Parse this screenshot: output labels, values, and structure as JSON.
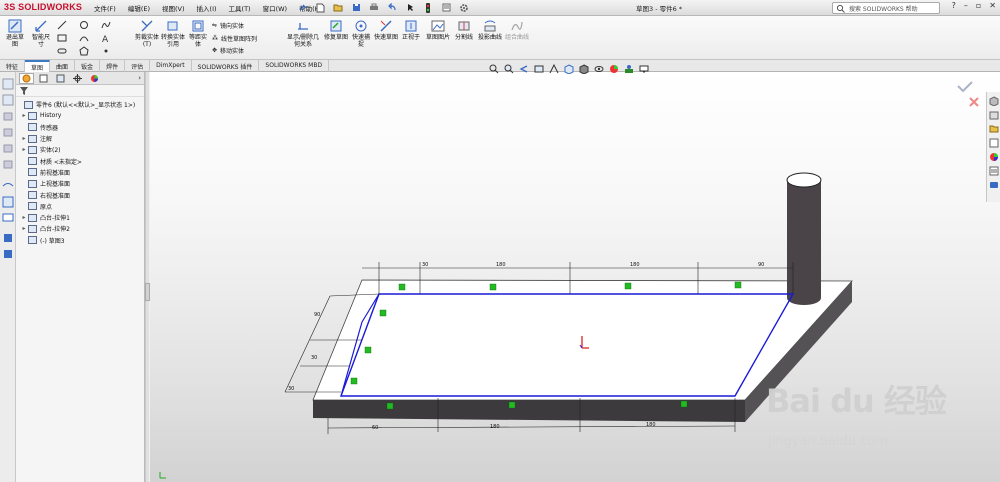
{
  "app": {
    "logo_text": "SOLIDWORKS",
    "logo_prefix": "3S",
    "doc_title": "草图3 - 零件6 *"
  },
  "menu": [
    "文件(F)",
    "编辑(E)",
    "视图(V)",
    "插入(I)",
    "工具(T)",
    "窗口(W)",
    "帮助(H)"
  ],
  "search": {
    "placeholder": "搜索 SOLIDWORKS 帮助"
  },
  "window_controls": [
    "?",
    "–",
    "▫",
    "✕"
  ],
  "ribbon": {
    "exit_sketch": "退出草图",
    "smart_dim": "智能尺寸",
    "trim": "剪裁实体(T)",
    "convert": "转换实体引用",
    "offset": "等距实体",
    "mirror": "镜向实体",
    "linear_pattern": "线性草图阵列",
    "move": "移动实体",
    "show_relations": "显示/删除几何关系",
    "repair": "修复草图",
    "quick_snap": "快速捕捉",
    "rapid_sketch": "快速草图",
    "normal_to": "正视于",
    "sketch_picture": "草图图片",
    "split_line": "分割线",
    "project_curve": "投影曲线",
    "combine_curve": "组合曲线"
  },
  "command_tabs": [
    "特征",
    "草图",
    "曲面",
    "钣金",
    "焊件",
    "评估",
    "DimXpert",
    "SOLIDWORKS 插件",
    "SOLIDWORKS MBD"
  ],
  "active_tab": "草图",
  "tree": [
    {
      "label": "零件6 (默认<<默认>_显示状态 1>)",
      "expand": "",
      "icon": "part-icon",
      "indent": 0
    },
    {
      "label": "History",
      "expand": "▸",
      "icon": "history-icon",
      "indent": 1
    },
    {
      "label": "传感器",
      "expand": "",
      "icon": "sensor-icon",
      "indent": 1
    },
    {
      "label": "注解",
      "expand": "▸",
      "icon": "annotation-icon",
      "indent": 1
    },
    {
      "label": "实体(2)",
      "expand": "▸",
      "icon": "solid-bodies-icon",
      "indent": 1
    },
    {
      "label": "材质 <未指定>",
      "expand": "",
      "icon": "material-icon",
      "indent": 1
    },
    {
      "label": "前视基准面",
      "expand": "",
      "icon": "plane-icon",
      "indent": 1
    },
    {
      "label": "上视基准面",
      "expand": "",
      "icon": "plane-icon",
      "indent": 1
    },
    {
      "label": "右视基准面",
      "expand": "",
      "icon": "plane-icon",
      "indent": 1
    },
    {
      "label": "原点",
      "expand": "",
      "icon": "origin-icon",
      "indent": 1
    },
    {
      "label": "凸台-拉伸1",
      "expand": "▸",
      "icon": "extrude-icon",
      "indent": 1
    },
    {
      "label": "凸台-拉伸2",
      "expand": "▸",
      "icon": "extrude-icon",
      "indent": 1
    },
    {
      "label": "(-) 草图3",
      "expand": "",
      "icon": "sketch-icon",
      "indent": 1
    }
  ],
  "dimensions": {
    "top": [
      "30",
      "180",
      "180",
      "90"
    ],
    "left": [
      "90",
      "30",
      "30"
    ],
    "bottom": [
      "60",
      "180",
      "180"
    ]
  },
  "watermark": {
    "main": "Bai du 经验",
    "sub": "jingyan.baidu.com"
  },
  "colors": {
    "sketch_blue": "#1a1ad8",
    "relation_green": "#22bb22",
    "logo_red": "#c8102e",
    "cylinder": "#4a4448"
  }
}
